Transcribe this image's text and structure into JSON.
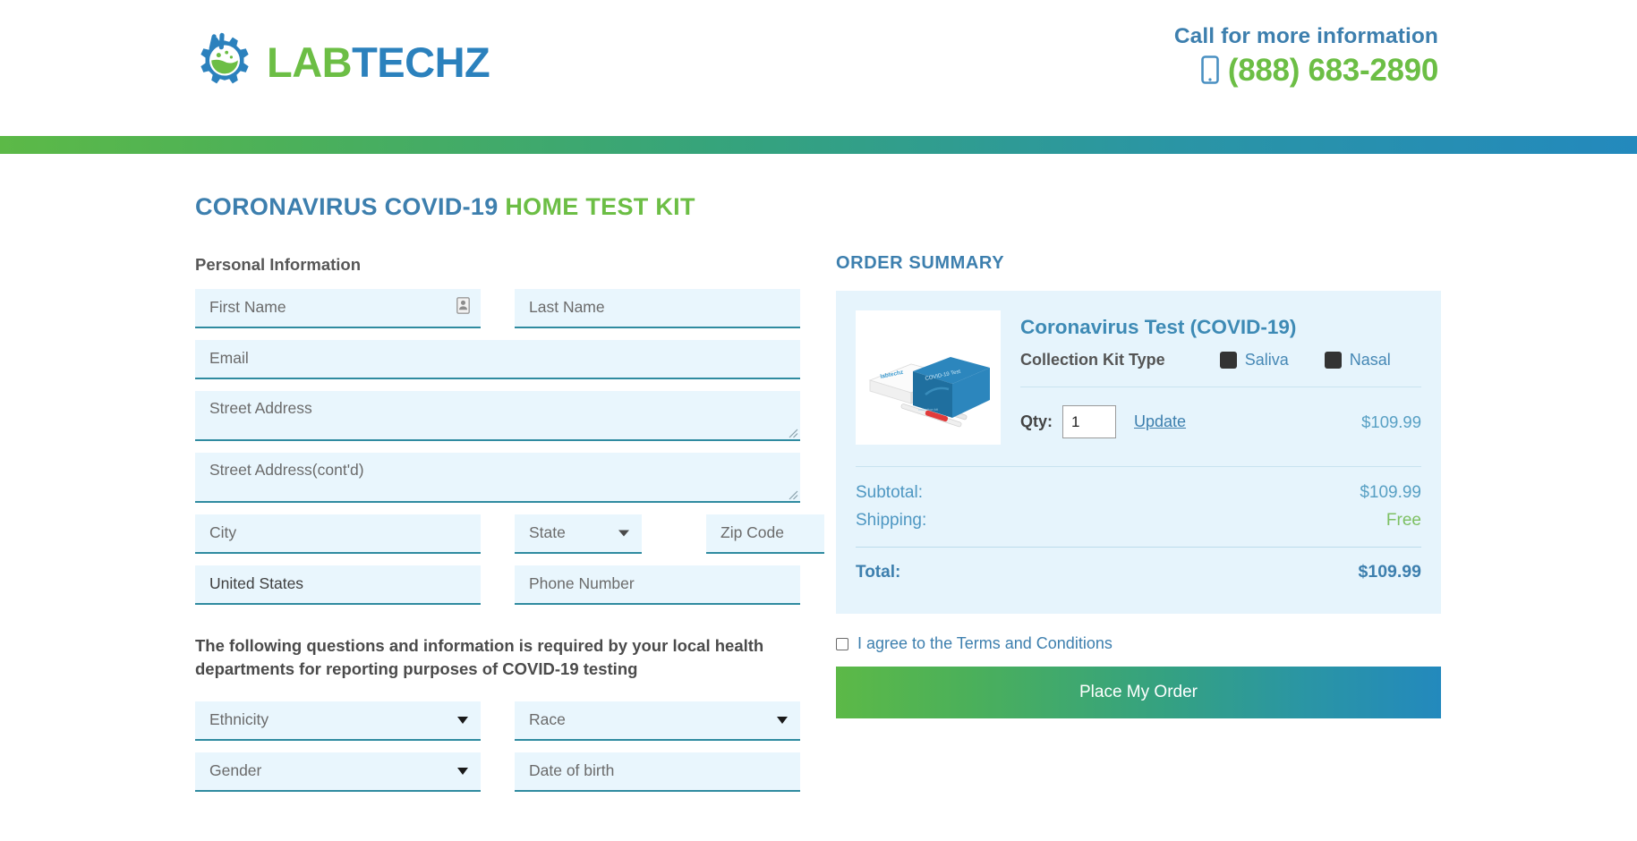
{
  "header": {
    "logo": {
      "icon": "gear-flask-icon",
      "text_part1": "LAB",
      "text_part2": "TECHZ",
      "color_green": "#6cbe45",
      "color_blue": "#2b81bd"
    },
    "call_title": "Call for more information",
    "phone_icon": "mobile-phone-icon",
    "phone_number": "(888) 683-2890"
  },
  "page": {
    "title_blue": "CORONAVIRUS COVID-19",
    "title_green": "HOME TEST KIT"
  },
  "form": {
    "section_label": "Personal Information",
    "first_name": {
      "placeholder": "First Name",
      "value": "",
      "icon": "contact-autofill-icon"
    },
    "last_name": {
      "placeholder": "Last Name",
      "value": ""
    },
    "email": {
      "placeholder": "Email",
      "value": ""
    },
    "street_address": {
      "placeholder": "Street Address",
      "value": ""
    },
    "street_address_2": {
      "placeholder": "Street Address(cont'd)",
      "value": ""
    },
    "city": {
      "placeholder": "City",
      "value": ""
    },
    "state": {
      "placeholder": "State",
      "value": ""
    },
    "zip": {
      "placeholder": "Zip Code",
      "value": ""
    },
    "country": {
      "value": "United States"
    },
    "phone": {
      "placeholder": "Phone Number",
      "value": ""
    },
    "notice": "The following questions and information is required by your local health departments for reporting purposes of COVID-19 testing",
    "ethnicity": {
      "placeholder": "Ethnicity",
      "value": ""
    },
    "race": {
      "placeholder": "Race",
      "value": ""
    },
    "gender": {
      "placeholder": "Gender",
      "value": ""
    },
    "dob": {
      "placeholder": "Date of birth",
      "value": ""
    }
  },
  "order": {
    "heading": "ORDER SUMMARY",
    "product_name": "Coronavirus Test (COVID-19)",
    "product_image_alt": "covid-test-kit-box",
    "kit_label": "Collection Kit Type",
    "kit_options": [
      {
        "label": "Saliva",
        "checked": true
      },
      {
        "label": "Nasal",
        "checked": true
      }
    ],
    "qty_label": "Qty:",
    "qty_value": "1",
    "update_label": "Update",
    "line_price": "$109.99",
    "subtotal_label": "Subtotal:",
    "subtotal_value": "$109.99",
    "shipping_label": "Shipping:",
    "shipping_value": "Free",
    "total_label": "Total:",
    "total_value": "$109.99",
    "terms_label": "I agree to the Terms and Conditions",
    "terms_checked": false,
    "place_order_label": "Place My Order"
  },
  "colors": {
    "brand_green": "#6cbe45",
    "brand_blue": "#2b81bd",
    "field_bg": "#e9f6fd",
    "field_underline": "#2f8ba0",
    "card_bg": "#e6f4fc",
    "free_green": "#7dc063"
  }
}
